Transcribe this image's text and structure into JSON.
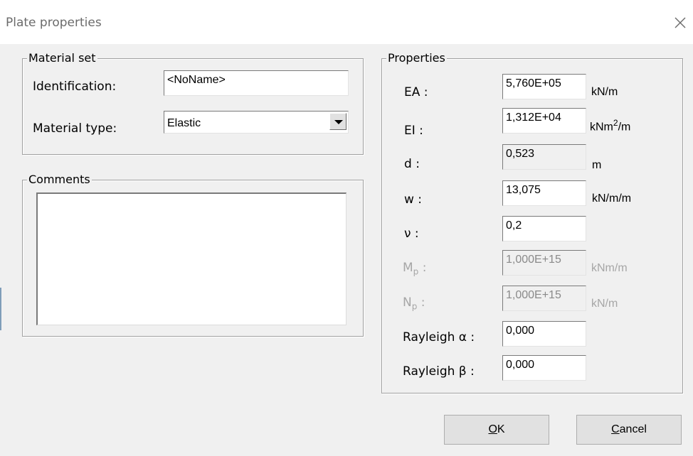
{
  "window": {
    "title": "Plate properties",
    "close_icon": "close-icon"
  },
  "material_set": {
    "legend": "Material set",
    "identification_label": "Identification:",
    "identification_value": "<NoName>",
    "material_type_label": "Material type:",
    "material_type_value": "Elastic"
  },
  "comments": {
    "legend": "Comments",
    "value": ""
  },
  "properties": {
    "legend": "Properties",
    "ea": {
      "label": "EA :",
      "value": "5,760E+05",
      "unit": "kN/m"
    },
    "ei": {
      "label": "EI :",
      "value": "1,312E+04",
      "unit_main": "kNm",
      "unit_sup": "2",
      "unit_tail": "/m"
    },
    "d": {
      "label": "d :",
      "value": "0,523",
      "unit": "m"
    },
    "w": {
      "label": "w :",
      "value": "13,075",
      "unit": "kN/m/m"
    },
    "nu": {
      "label": "ν :",
      "value": "0,2"
    },
    "mp": {
      "label_main": "M",
      "label_sub": "p",
      "label_tail": " :",
      "value": "1,000E+15",
      "unit": "kNm/m"
    },
    "np": {
      "label_main": "N",
      "label_sub": "p",
      "label_tail": " :",
      "value": "1,000E+15",
      "unit": "kN/m"
    },
    "rayleigh_alpha": {
      "label": "Rayleigh α :",
      "value": "0,000"
    },
    "rayleigh_beta": {
      "label": "Rayleigh β :",
      "value": "0,000"
    }
  },
  "buttons": {
    "ok_accel": "O",
    "ok_rest": "K",
    "cancel_accel": "C",
    "cancel_rest": "ancel"
  }
}
